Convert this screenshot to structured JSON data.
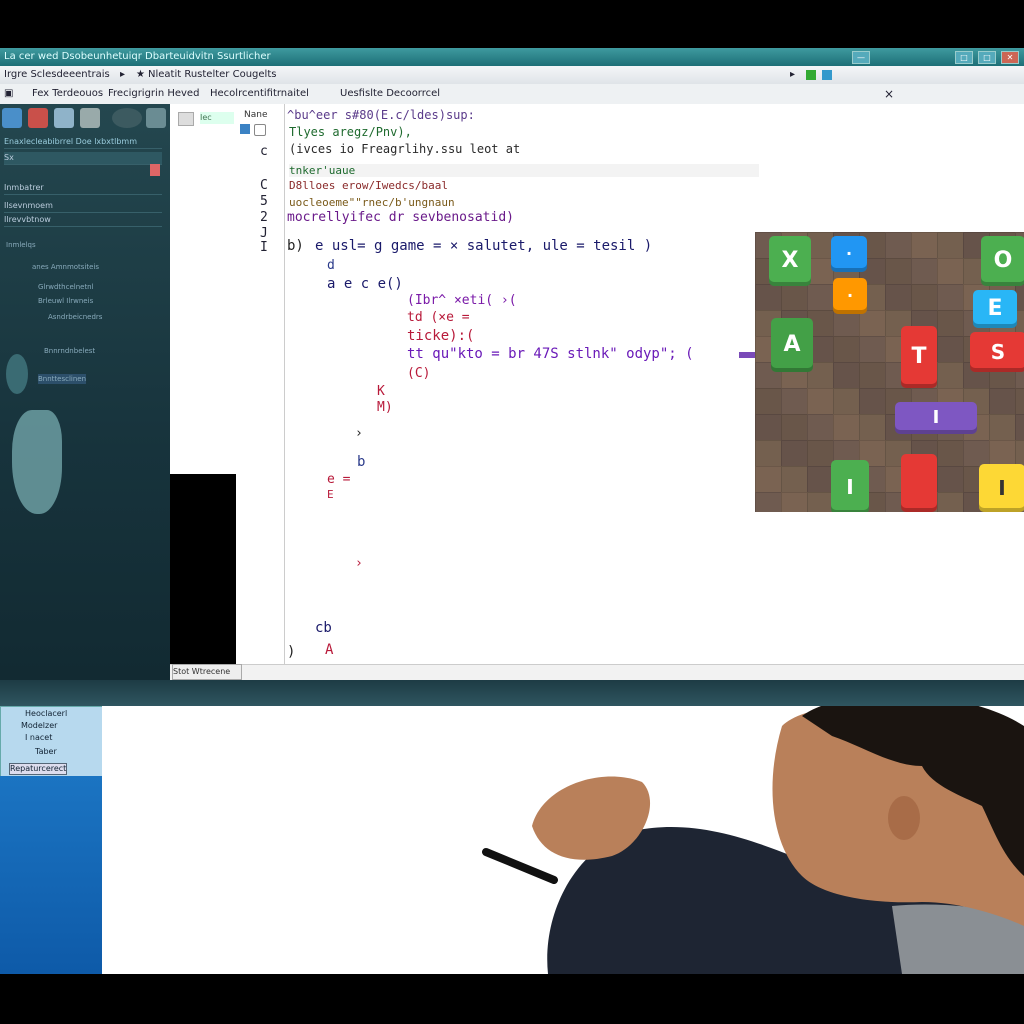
{
  "window": {
    "title": "La cer wed Dsobeunhetuiqr Dbarteuidvitn Ssurtlicher",
    "controls": [
      "—",
      "□",
      "✕"
    ],
    "accent_color": "#1d6f77"
  },
  "address_bar": {
    "left_text": "Irgre Sclesdeeentrais",
    "right_text": "Nleatit Rustelter Cougelts"
  },
  "tab_bar": {
    "items": [
      "Fex Terdeouos",
      "Frecigrigrin Heved",
      "Hecolrcentifitrnaitel",
      "Uesfislte Decoorrcel"
    ],
    "close_label": "×"
  },
  "sidebar": {
    "header": "Enaxlecleabibrrel Doe lxbxtlbmm",
    "rows": [
      "Sx",
      "Inmbatrer",
      "Ilsevnmoem",
      "Ilrevvbtnow"
    ],
    "sub_items": [
      "Inmlelqs",
      "anes Amnmotsiteis",
      "Glrwdthcelnetnl",
      "Brleuwl Ilrwneis",
      "Asndrbeicnedrs",
      "Bnnrndnbelest",
      "Bnnttesclinen"
    ]
  },
  "gutter": {
    "label": "Nane",
    "middle_icon_label": "Iec",
    "line_markers": [
      "c",
      "C",
      "5",
      "2",
      "J",
      "I"
    ]
  },
  "editor": {
    "header_lines": [
      "^bu^eer s#80(E.c/ldes)sup:",
      "Tlyes aregz/Pnv),",
      "(ivces io  Freagrlihy.ssu leot at",
      "tnker'uaue",
      "D8lloes erow/Iwedcs/baal",
      "uocleoeme\"\"rnec/b'ungnaun",
      "mocrellyifec dr sevbenosatid)"
    ],
    "code_lines": [
      {
        "prefix": "b)",
        "text": "e usl= g game = × salutet, ule = tesil )"
      },
      {
        "prefix": "",
        "text": "d"
      },
      {
        "prefix": "",
        "text": "a e c e()"
      },
      {
        "prefix": "",
        "text": "(Ibr^ ×eti( ›("
      },
      {
        "prefix": "",
        "text": "td (×e ="
      },
      {
        "prefix": "",
        "text": "ticke):("
      },
      {
        "prefix": "",
        "text": "tt qu\"kto = br 47S stlnk\" odyp\"; ("
      },
      {
        "prefix": "",
        "text": "(C)"
      },
      {
        "prefix": "",
        "text": "K"
      },
      {
        "prefix": "",
        "text": "M)"
      },
      {
        "prefix": "",
        "text": "›"
      },
      {
        "prefix": "",
        "text": "b"
      },
      {
        "prefix": "",
        "text": "e ="
      },
      {
        "prefix": "",
        "text": "E"
      },
      {
        "prefix": "",
        "text": "›"
      },
      {
        "prefix": "",
        "text": "cb"
      },
      {
        "prefix": ")",
        "text": "A"
      }
    ],
    "status": "Stot Wtrecene"
  },
  "game": {
    "tiles": [
      {
        "letter": "X",
        "color": "#4caf50"
      },
      {
        "letter": "·",
        "color": "#2196f3"
      },
      {
        "letter": "O",
        "color": "#4caf50"
      },
      {
        "letter": "·",
        "color": "#ff9800"
      },
      {
        "letter": "E",
        "color": "#29b6f6"
      },
      {
        "letter": "A",
        "color": "#43a047"
      },
      {
        "letter": "T",
        "color": "#e53935"
      },
      {
        "letter": "S",
        "color": "#e53935"
      },
      {
        "letter": "I",
        "color": "#7e57c2"
      },
      {
        "letter": "I",
        "color": "#4caf50"
      },
      {
        "letter": "",
        "color": "#e53935"
      },
      {
        "letter": "I",
        "color": "#fdd835"
      }
    ]
  },
  "lower_window": {
    "side_items": [
      "Heoclacerl",
      "Modelzer",
      "I   nacet",
      "Taber",
      "Repaturcerect"
    ]
  }
}
